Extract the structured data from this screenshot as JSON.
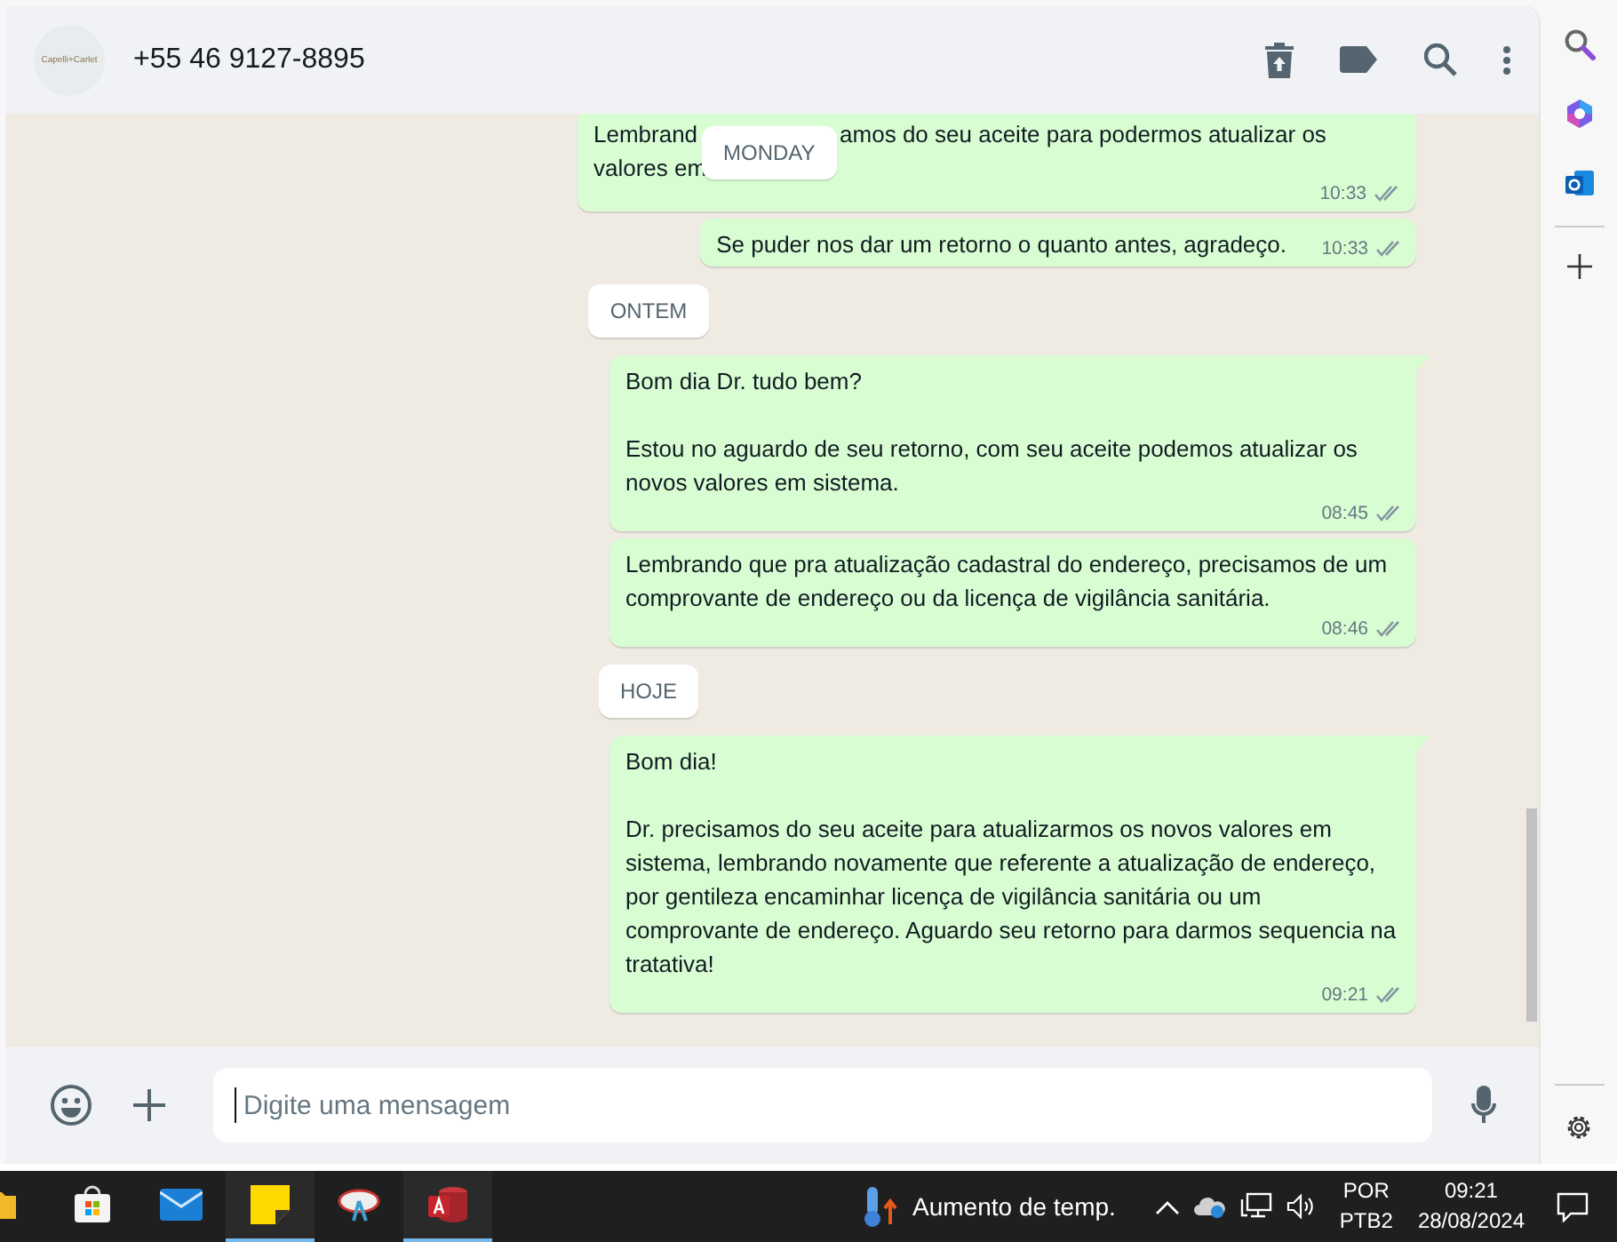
{
  "chat_header": {
    "avatar_text": "Capelli+Carlet",
    "contact": "+55 46 9127-8895"
  },
  "floating_date": "MONDAY",
  "items": [
    {
      "kind": "covered_message",
      "visible_start": "Lembrand",
      "visible_rest": "amos do seu aceite para podermos atualizar os",
      "second_line": "valores em",
      "time": "10:33",
      "read": false
    },
    {
      "kind": "message",
      "text": "Se puder nos dar um retorno o quanto antes, agradeço.",
      "time": "10:33",
      "read": false,
      "tail": false
    },
    {
      "kind": "date",
      "label": "ONTEM"
    },
    {
      "kind": "message",
      "text": "Bom dia Dr. tudo bem?\n\nEstou no aguardo de seu retorno, com seu aceite podemos atualizar os novos valores em sistema.",
      "time": "08:45",
      "read": false,
      "tail": true
    },
    {
      "kind": "message",
      "text": "Lembrando que pra atualização cadastral do endereço, precisamos de um comprovante de endereço ou da licença de vigilância sanitária.",
      "time": "08:46",
      "read": false,
      "tail": false
    },
    {
      "kind": "date",
      "label": "HOJE"
    },
    {
      "kind": "message",
      "text": "Bom dia!\n\nDr. precisamos do seu aceite para atualizarmos os novos valores em sistema, lembrando novamente que referente a atualização de endereço, por gentileza encaminhar licença de vigilância sanitária ou um comprovante de endereço. Aguardo seu retorno para darmos sequencia na tratativa!",
      "time": "09:21",
      "read": false,
      "tail": true
    }
  ],
  "composer": {
    "placeholder": "Digite uma mensagem"
  },
  "taskbar": {
    "apps": [
      {
        "kind": "folder",
        "active": false
      },
      {
        "kind": "store",
        "active": false
      },
      {
        "kind": "mail",
        "active": false
      },
      {
        "kind": "notes",
        "active": true
      },
      {
        "kind": "dish",
        "active": false
      },
      {
        "kind": "access",
        "active": true
      }
    ],
    "weather": "Aumento de temp.",
    "language": "POR",
    "layout": "PTB2",
    "time": "09:21",
    "date": "28/08/2024"
  }
}
